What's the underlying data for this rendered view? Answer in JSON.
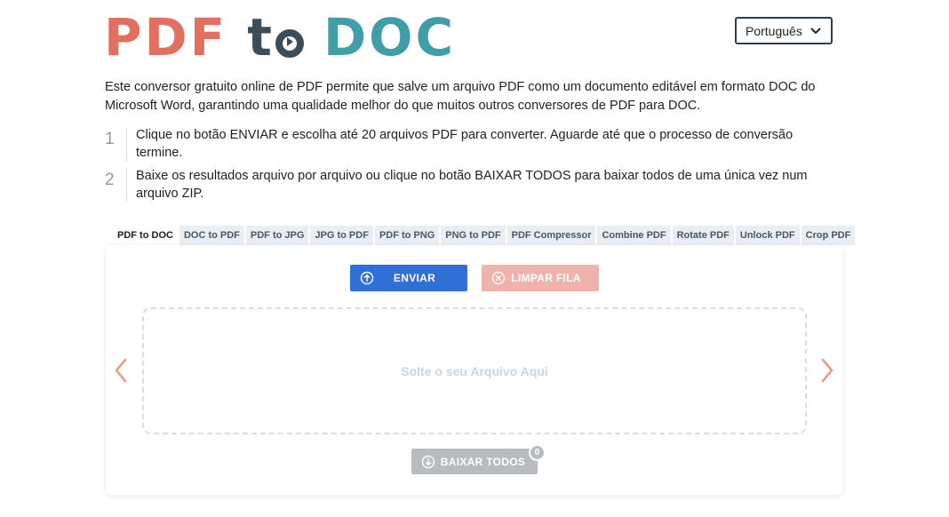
{
  "logo": {
    "part1": "PDF",
    "part2": "t",
    "part3": "DOC"
  },
  "language": {
    "selected": "Português"
  },
  "intro": "Este conversor gratuito online de PDF permite que salve um arquivo PDF como um documento editável em formato DOC do Microsoft Word, garantindo uma qualidade melhor do que muitos outros conversores de PDF para DOC.",
  "steps": [
    {
      "num": "1",
      "text": "Clique no botão ENVIAR e escolha até 20 arquivos PDF para converter. Aguarde até que o processo de conversão termine."
    },
    {
      "num": "2",
      "text": "Baixe os resultados arquivo por arquivo ou clique no botão BAIXAR TODOS para baixar todos de uma única vez num arquivo ZIP."
    }
  ],
  "tabs": [
    {
      "label": "PDF to DOC",
      "active": true
    },
    {
      "label": "DOC to PDF"
    },
    {
      "label": "PDF to JPG"
    },
    {
      "label": "JPG to PDF"
    },
    {
      "label": "PDF to PNG"
    },
    {
      "label": "PNG to PDF"
    },
    {
      "label": "PDF Compressor"
    },
    {
      "label": "Combine PDF"
    },
    {
      "label": "Rotate PDF"
    },
    {
      "label": "Unlock PDF"
    },
    {
      "label": "Crop PDF"
    }
  ],
  "panel": {
    "upload_label": "ENVIAR",
    "clear_label": "LIMPAR FILA",
    "dropzone_hint": "Solte o seu Arquivo Aqui",
    "download_all_label": "BAIXAR TODOS",
    "download_count": "0"
  },
  "icons": {
    "upload": "arrow-up-circle-icon",
    "clear": "x-circle-icon",
    "download": "arrow-down-circle-icon",
    "prev": "chevron-left-icon",
    "next": "chevron-right-icon",
    "language": "chevron-down-icon"
  },
  "colors": {
    "logo_pdf": "#e2705f",
    "logo_to": "#3c4d5a",
    "logo_doc": "#3f9ea8",
    "upload_button": "#2f6fd8",
    "clear_button": "#efb3ab",
    "download_button": "#b8bcc1",
    "arrows": "#ec9a8d"
  }
}
